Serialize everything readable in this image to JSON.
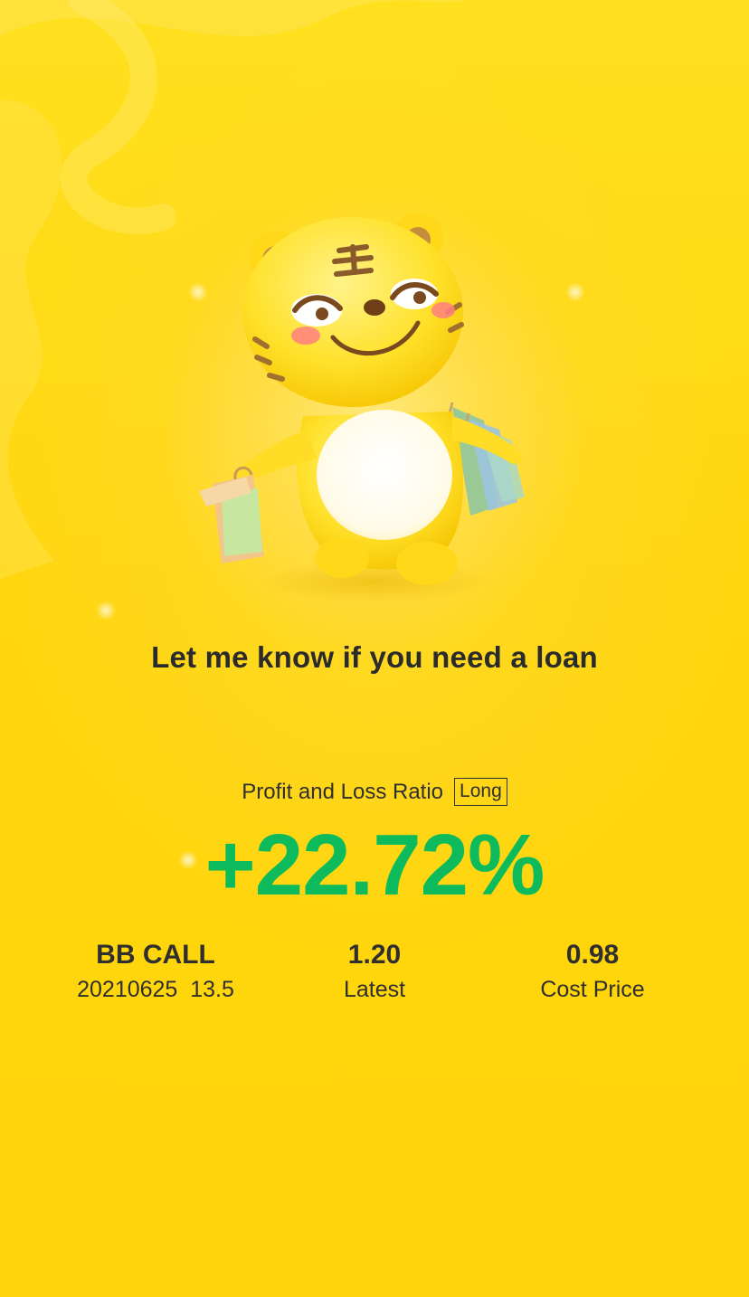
{
  "headline": "Let me know if you need a loan",
  "profit_loss": {
    "label": "Profit and Loss Ratio",
    "badge": "Long",
    "ratio": "+22.72%",
    "ratio_color": "#0dbb5c"
  },
  "stats": [
    {
      "value": "BB CALL",
      "label": "20210625  13.5"
    },
    {
      "value": "1.20",
      "label": "Latest"
    },
    {
      "value": "0.98",
      "label": "Cost Price"
    }
  ],
  "mascot": {
    "name": "tiger-mascot-with-shopping-bags-icon"
  },
  "colors": {
    "background": "#ffd60f",
    "text": "#2f2f2f",
    "accent_green": "#0dbb5c"
  }
}
